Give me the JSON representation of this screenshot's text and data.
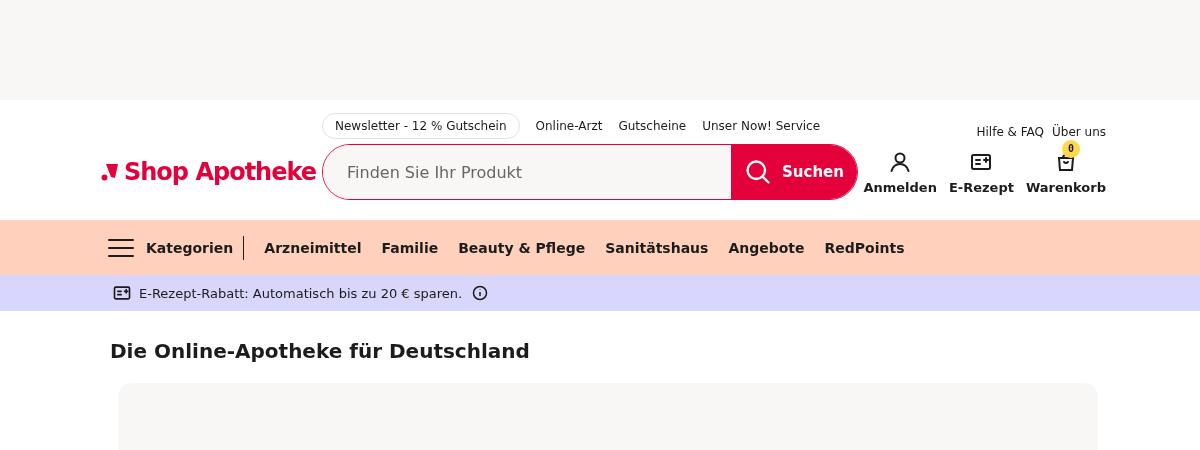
{
  "top_links": [
    "Newsletter - 12 % Gutschein",
    "Online-Arzt",
    "Gutscheine",
    "Unser Now! Service"
  ],
  "service_links": [
    "Hilfe & FAQ",
    "Über uns"
  ],
  "logo": "Shop Apotheke",
  "search": {
    "placeholder": "Finden Sie Ihr Produkt",
    "button": "Suchen"
  },
  "actions": [
    {
      "kind": "account",
      "label": "Anmelden"
    },
    {
      "kind": "prescription",
      "label": "E-Rezept"
    },
    {
      "kind": "cart",
      "label": "Warenkorb",
      "badge": "0"
    }
  ],
  "nav": {
    "menu_label": "Kategorien",
    "items": [
      "Arzneimittel",
      "Familie",
      "Beauty & Pflege",
      "Sanitätshaus",
      "Angebote",
      "RedPoints"
    ]
  },
  "banner": "E-Rezept-Rabatt: Automatisch bis zu 20 € sparen.",
  "heading": "Die Online-Apotheke für Deutschland"
}
